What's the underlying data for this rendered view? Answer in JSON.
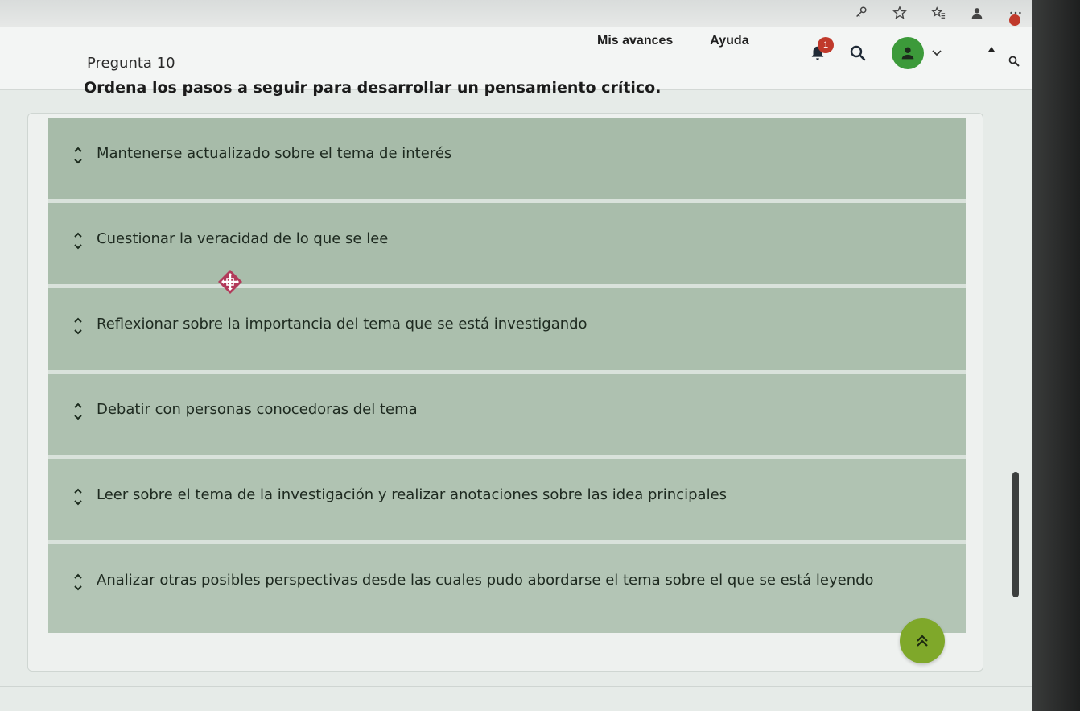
{
  "nav": {
    "progress_label": "Mis avances",
    "help_label": "Ayuda",
    "notification_count": "1"
  },
  "question": {
    "number_label": "Pregunta 10",
    "prompt": "Ordena los pasos a seguir para desarrollar un pensamiento crítico."
  },
  "items": [
    {
      "label": "Mantenerse actualizado sobre el tema de interés"
    },
    {
      "label": "Cuestionar la veracidad de lo que se lee"
    },
    {
      "label": "Reflexionar sobre la importancia del tema que se está investigando"
    },
    {
      "label": "Debatir con personas conocedoras del tema"
    },
    {
      "label": "Leer sobre el tema de la investigación y realizar anotaciones sobre las idea principales"
    },
    {
      "label": "Analizar otras posibles perspectivas desde las cuales pudo abordarse el tema sobre el que se está leyendo"
    }
  ],
  "colors": {
    "item_bg": "#a7bba9",
    "avatar_bg": "#3c9a3a",
    "back_to_top_bg": "#7fa82a",
    "badge_bg": "#c0392b"
  },
  "icons": {
    "browser": [
      "key-icon",
      "star-icon",
      "favorites-icon",
      "profile-icon",
      "more-icon"
    ],
    "nav": [
      "bell-icon",
      "search-icon",
      "user-icon",
      "chevron-down-icon"
    ],
    "item": [
      "chevron-up-icon",
      "chevron-down-icon"
    ],
    "misc": [
      "move-cursor-icon",
      "double-chevron-up-icon"
    ]
  }
}
